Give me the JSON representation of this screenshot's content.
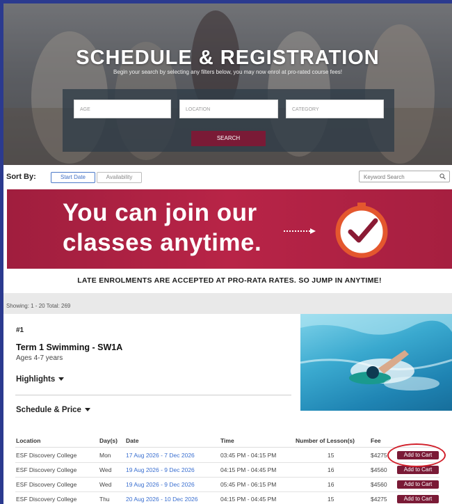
{
  "hero": {
    "title": "SCHEDULE & REGISTRATION",
    "subtitle": "Begin your search by selecting any filters below, you may now enrol at pro-rated course fees!",
    "filters": {
      "age_placeholder": "AGE",
      "location_placeholder": "LOCATION",
      "category_placeholder": "CATEGORY"
    },
    "search_label": "SEARCH"
  },
  "sort": {
    "label": "Sort By:",
    "options": [
      "Start Date",
      "Availability"
    ],
    "active": "Start Date",
    "keyword_placeholder": "Keyword Search"
  },
  "banner": {
    "line1": "You can join our",
    "line2": "classes anytime.",
    "late_notice": "LATE ENROLMENTS ARE ACCEPTED AT PRO-RATA RATES. SO JUMP IN ANYTIME!"
  },
  "results": {
    "showing": "Showing: 1 - 20 Total: 269"
  },
  "course": {
    "number": "#1",
    "title": "Term 1 Swimming - SW1A",
    "ages": "Ages 4-7 years",
    "highlights_label": "Highlights",
    "schedule_label": "Schedule & Price",
    "columns": [
      "Location",
      "Day(s)",
      "Date",
      "Time",
      "Number of Lesson(s)",
      "Fee"
    ],
    "rows": [
      {
        "location": "ESF Discovery College",
        "day": "Mon",
        "date": "17 Aug 2026 - 7 Dec 2026",
        "time": "03:45 PM - 04:15 PM",
        "lessons": "15",
        "fee": "$4275",
        "cart": "Add to Cart"
      },
      {
        "location": "ESF Discovery College",
        "day": "Wed",
        "date": "19 Aug 2026 - 9 Dec 2026",
        "time": "04:15 PM - 04:45 PM",
        "lessons": "16",
        "fee": "$4560",
        "cart": "Add to Cart"
      },
      {
        "location": "ESF Discovery College",
        "day": "Wed",
        "date": "19 Aug 2026 - 9 Dec 2026",
        "time": "05:45 PM - 06:15 PM",
        "lessons": "16",
        "fee": "$4560",
        "cart": "Add to Cart"
      },
      {
        "location": "ESF Discovery College",
        "day": "Thu",
        "date": "20 Aug 2026 - 10 Dec 2026",
        "time": "04:15 PM - 04:45 PM",
        "lessons": "15",
        "fee": "$4275",
        "cart": "Add to Cart"
      }
    ]
  },
  "colors": {
    "brand": "#7a1a36",
    "banner": "#b82447",
    "link": "#3a6fd0",
    "highlight": "#d11f2a"
  }
}
